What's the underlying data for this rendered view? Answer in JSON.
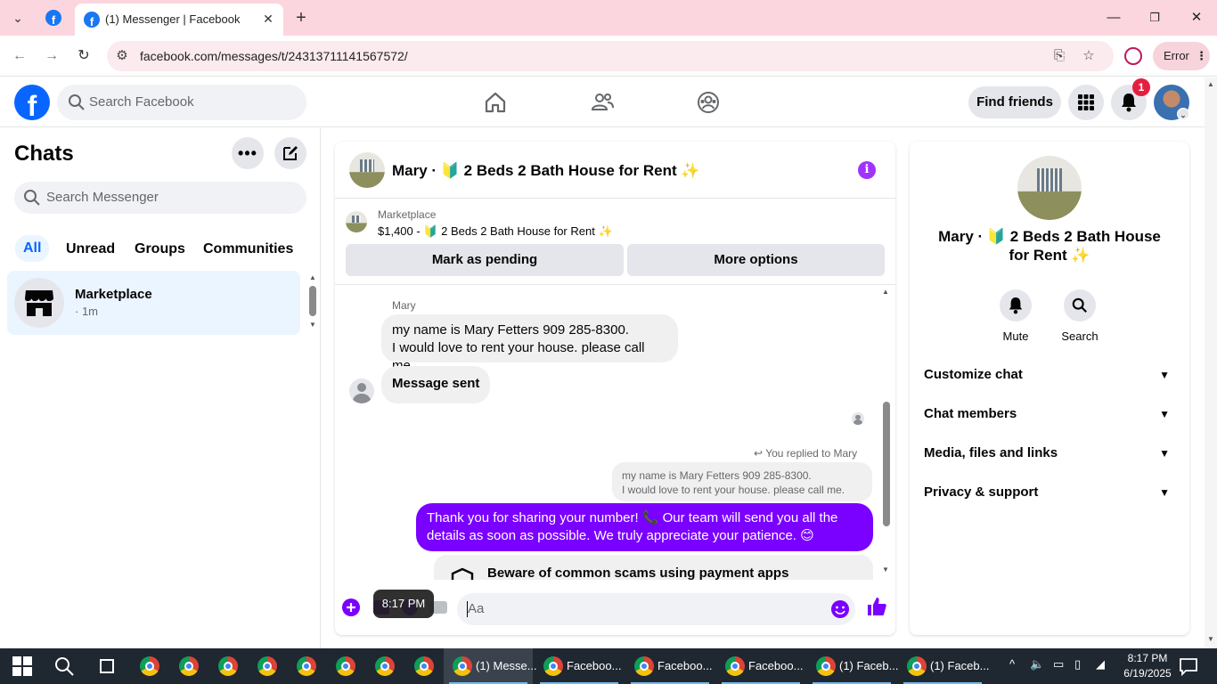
{
  "browser": {
    "tab_title": "(1) Messenger | Facebook",
    "url": "facebook.com/messages/t/24313711141567572/",
    "error_label": "Error"
  },
  "fb_header": {
    "search_placeholder": "Search Facebook",
    "find_friends_label": "Find friends",
    "notification_count": "1"
  },
  "sidebar": {
    "title": "Chats",
    "search_placeholder": "Search Messenger",
    "filters": [
      "All",
      "Unread",
      "Groups",
      "Communities"
    ],
    "active_filter": "All",
    "chats": [
      {
        "name": "Marketplace",
        "time": "· 1m"
      }
    ]
  },
  "conversation": {
    "title": "Mary · 🔰 2 Beds 2 Bath House for Rent ✨",
    "marketplace": {
      "label": "Marketplace",
      "listing": "$1,400 - 🔰 2 Beds 2 Bath House for Rent ✨",
      "mark_pending_label": "Mark as pending",
      "more_options_label": "More options"
    },
    "messages": {
      "sender_name": "Mary",
      "incoming_line1": "my name is Mary Fetters 909 285-8300.",
      "incoming_line2": "I would love to rent your house. please call me.",
      "incoming_2": "Message sent",
      "replied_label": "You replied to Mary",
      "quote_line1": "my name is Mary Fetters 909 285-8300.",
      "quote_line2": "I would love to rent your house. please call me.",
      "outgoing": "Thank you for sharing your number! 📞 Our team will send you all the details as soon as possible. We truly appreciate your patience. 😊",
      "warning": "Beware of common scams using payment apps"
    },
    "composer": {
      "placeholder": "Aa",
      "tooltip": "8:17 PM"
    }
  },
  "info_panel": {
    "name": "Mary · 🔰 2 Beds 2 Bath House for Rent ✨",
    "actions": [
      "Mute",
      "Search"
    ],
    "sections": [
      "Customize chat",
      "Chat members",
      "Media, files and links",
      "Privacy & support"
    ]
  },
  "taskbar": {
    "items": [
      "(1) Messe...",
      "Faceboo...",
      "Faceboo...",
      "Faceboo...",
      "(1) Faceb...",
      "(1) Faceb..."
    ],
    "time": "8:17 PM",
    "date": "6/19/2025"
  },
  "colors": {
    "fb_blue": "#0866ff",
    "messenger_purple": "#7a00ff",
    "tab_strip": "#fbd6df",
    "notification_red": "#e41e3f",
    "taskbar": "#1f2730"
  }
}
